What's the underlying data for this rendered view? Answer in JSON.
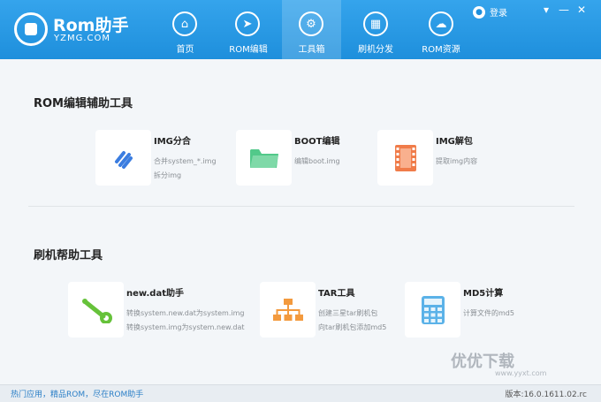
{
  "header": {
    "logo_title": "Rom助手",
    "logo_sub": "YZMG.COM",
    "nav": [
      {
        "label": "首页",
        "icon": "home-icon",
        "glyph": "⌂"
      },
      {
        "label": "ROM编辑",
        "icon": "cursor-icon",
        "glyph": "➤"
      },
      {
        "label": "工具箱",
        "icon": "gear-icon",
        "glyph": "⚙"
      },
      {
        "label": "刷机分发",
        "icon": "grid-icon",
        "glyph": "▦"
      },
      {
        "label": "ROM资源",
        "icon": "cloud-icon",
        "glyph": "☁"
      }
    ],
    "login_label": "登录",
    "window_buttons": [
      "▾",
      "—",
      "✕"
    ]
  },
  "sections": [
    {
      "title": "ROM编辑辅助工具",
      "tools": [
        {
          "name": "IMG分合",
          "desc": [
            "合并system_*.img",
            "拆分img"
          ]
        },
        {
          "name": "BOOT编辑",
          "desc": [
            "编辑boot.img"
          ]
        },
        {
          "name": "IMG解包",
          "desc": [
            "提取img内容"
          ]
        }
      ]
    },
    {
      "title": "刷机帮助工具",
      "tools": [
        {
          "name": "new.dat助手",
          "desc": [
            "转换system.new.dat为system.img",
            "转换system.img为system.new.dat"
          ]
        },
        {
          "name": "TAR工具",
          "desc": [
            "创建三星tar刷机包",
            "向tar刷机包添加md5"
          ]
        },
        {
          "name": "MD5计算",
          "desc": [
            "计算文件的md5"
          ]
        }
      ]
    }
  ],
  "footer": {
    "left": "热门应用，精品ROM，尽在ROM助手",
    "version": "版本:16.0.1611.02.rc"
  },
  "watermark": {
    "text": "优优下载",
    "sub": "www.yyxt.com"
  },
  "colors": {
    "header": "#1e8fdc",
    "icon_blue": "#3b7de0",
    "icon_green": "#52c98a",
    "icon_orange": "#f07c4a",
    "icon_calc": "#5bb2e8"
  }
}
